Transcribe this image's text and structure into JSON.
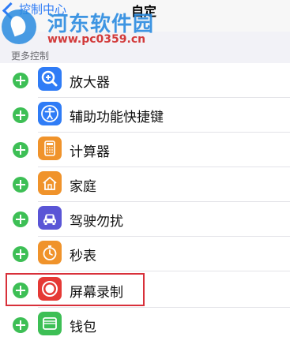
{
  "nav": {
    "back_label": "控制中心",
    "title": "自定"
  },
  "watermark": {
    "site_name": "河东软件园",
    "url": "www.pc0359.cn"
  },
  "section": {
    "title": "更多控制"
  },
  "items": [
    {
      "label": "放大器",
      "icon": "magnifier-icon",
      "color": "#2f7cf6"
    },
    {
      "label": "辅助功能快捷键",
      "icon": "accessibility-icon",
      "color": "#2f7cf6"
    },
    {
      "label": "计算器",
      "icon": "calculator-icon",
      "color": "#f0932b"
    },
    {
      "label": "家庭",
      "icon": "home-icon",
      "color": "#f0932b"
    },
    {
      "label": "驾驶勿扰",
      "icon": "car-icon",
      "color": "#5a55d6"
    },
    {
      "label": "秒表",
      "icon": "stopwatch-icon",
      "color": "#f0932b"
    },
    {
      "label": "屏幕录制",
      "icon": "screen-record-icon",
      "color": "#e53935"
    },
    {
      "label": "钱包",
      "icon": "wallet-icon",
      "color": "#3dbf55"
    }
  ]
}
